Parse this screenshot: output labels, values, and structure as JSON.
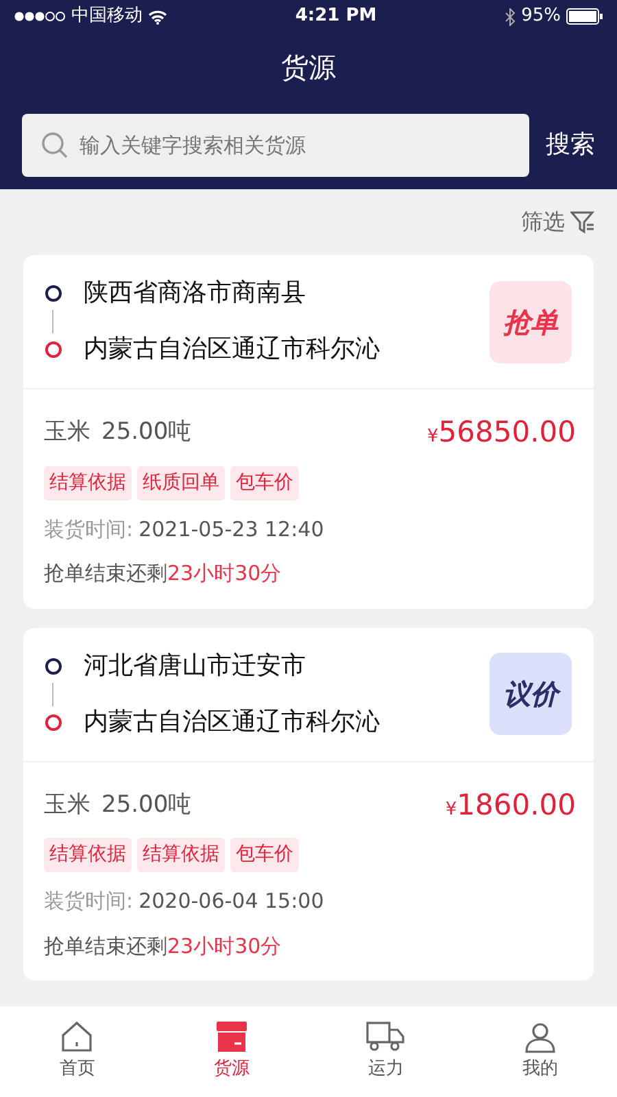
{
  "status_bar": {
    "carrier": "中国移动",
    "time": "4:21 PM",
    "battery": "95%"
  },
  "header": {
    "title": "货源",
    "search_placeholder": "输入关键字搜索相关货源",
    "search_button": "搜索"
  },
  "filter": {
    "label": "筛选"
  },
  "cards": [
    {
      "origin": "陕西省商洛市商南县",
      "destination": "内蒙古自治区通辽市科尔沁",
      "badge": {
        "kind": "grab",
        "label": "抢单"
      },
      "goods": "玉米",
      "weight": "25.00吨",
      "currency": "¥",
      "price": "56850.00",
      "tags": [
        "结算依据",
        "纸质回单",
        "包车价"
      ],
      "load_label": "装货时间:",
      "load_time": "2021-05-23 12:40",
      "remain_label": "抢单结束还剩",
      "remain": "23小时30分"
    },
    {
      "origin": "河北省唐山市迁安市",
      "destination": "内蒙古自治区通辽市科尔沁",
      "badge": {
        "kind": "negotiate",
        "label": "议价"
      },
      "goods": "玉米",
      "weight": "25.00吨",
      "currency": "¥",
      "price": "1860.00",
      "tags": [
        "结算依据",
        "结算依据",
        "包车价"
      ],
      "load_label": "装货时间:",
      "load_time": "2020-06-04 15:00",
      "remain_label": "抢单结束还剩",
      "remain": "23小时30分"
    }
  ],
  "tab_bar": [
    {
      "label": "首页",
      "kind": "home",
      "selected": false
    },
    {
      "label": "货源",
      "kind": "box",
      "selected": true
    },
    {
      "label": "运力",
      "kind": "truck",
      "selected": false
    },
    {
      "label": "我的",
      "kind": "user",
      "selected": false
    }
  ]
}
